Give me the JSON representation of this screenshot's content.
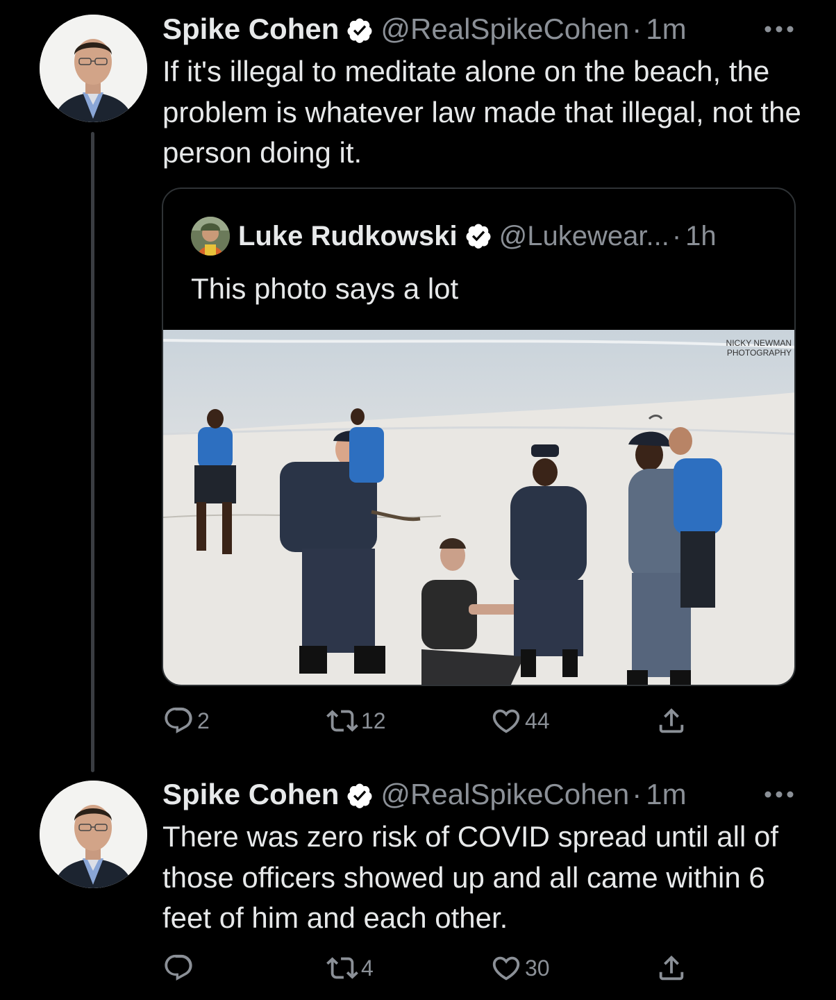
{
  "colors": {
    "background": "#000000",
    "text": "#e7e9ea",
    "muted": "#8b9097",
    "verified": "#ffffff",
    "border": "#2f3336"
  },
  "tweets": [
    {
      "author": {
        "name": "Spike Cohen",
        "handle": "@RealSpikeCohen",
        "verified": true
      },
      "dot": "·",
      "time": "1m",
      "text": "If it's illegal to meditate alone on the beach, the problem is whatever law made that illegal, not the person doing it.",
      "quote": {
        "author": {
          "name": "Luke Rudkowski",
          "handle": "@Lukewear...",
          "verified": true
        },
        "dot": "·",
        "time": "1h",
        "text": "This photo says a lot",
        "photo_watermark": [
          "NICKY NEWMAN",
          "PHOTOGRAPHY"
        ]
      },
      "actions": {
        "replies": "2",
        "retweets": "12",
        "likes": "44"
      },
      "icons": [
        "reply-icon",
        "retweet-icon",
        "like-icon",
        "share-icon",
        "more-icon",
        "verified-icon"
      ]
    },
    {
      "author": {
        "name": "Spike Cohen",
        "handle": "@RealSpikeCohen",
        "verified": true
      },
      "dot": "·",
      "time": "1m",
      "text": "There was zero risk of COVID spread until all of those officers showed up and all came within 6 feet of him and each other.",
      "actions": {
        "replies": "",
        "retweets": "4",
        "likes": "30"
      },
      "icons": [
        "reply-icon",
        "retweet-icon",
        "like-icon",
        "share-icon",
        "more-icon",
        "verified-icon"
      ]
    }
  ]
}
